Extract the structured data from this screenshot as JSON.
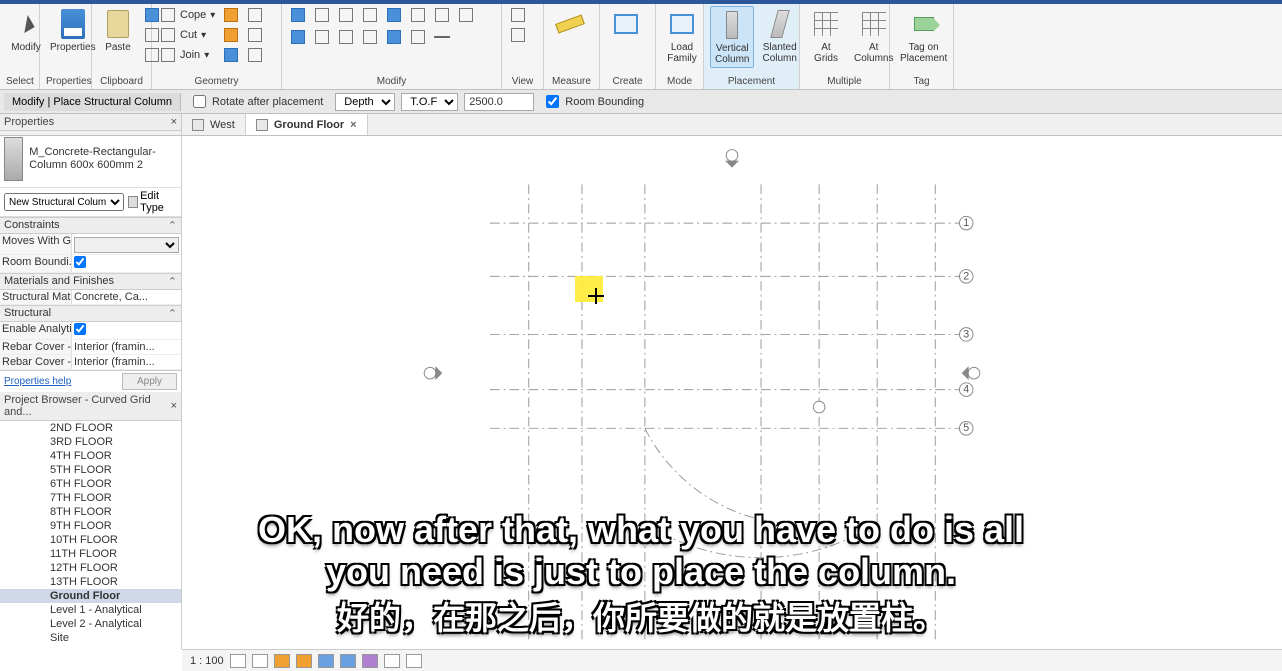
{
  "ribbon": {
    "groups": {
      "select": "Select",
      "properties": "Properties",
      "clipboard": "Clipboard",
      "geometry": "Geometry",
      "modify": "Modify",
      "view": "View",
      "measure": "Measure",
      "create": "Create",
      "mode": "Mode",
      "placement": "Placement",
      "multiple": "Multiple",
      "tag": "Tag"
    },
    "modify_label": "Modify",
    "properties_label": "Properties",
    "paste_label": "Paste",
    "cope_label": "Cope",
    "cut_label": "Cut",
    "join_label": "Join",
    "load_family": "Load\nFamily",
    "vertical_column": "Vertical\nColumn",
    "slanted_column": "Slanted\nColumn",
    "at_grids": "At\nGrids",
    "at_columns": "At\nColumns",
    "tag_on_placement": "Tag on\nPlacement"
  },
  "options_bar": {
    "context": "Modify | Place Structural Column",
    "rotate_after": "Rotate after placement",
    "depth_label": "Depth",
    "depth_mode": "T.O.F",
    "depth_value": "2500.0",
    "room_bounding": "Room Bounding"
  },
  "tabs": {
    "west": "West",
    "ground": "Ground Floor"
  },
  "properties_panel": {
    "title": "Properties",
    "type_name": "M_Concrete-Rectangular-Column 600x 600mm 2",
    "category": "New Structural Colum",
    "edit_type": "Edit Type",
    "cat_constraints": "Constraints",
    "moves_with": "Moves With G...",
    "room_bounding": "Room Boundi...",
    "cat_materials": "Materials and Finishes",
    "structural_mat": "Structural Mat...",
    "structural_mat_val": "Concrete, Ca...",
    "cat_structural": "Structural",
    "enable_analytic": "Enable Analyti...",
    "rebar1": "Rebar Cover - ...",
    "rebar1_val": "Interior (framin...",
    "rebar2": "Rebar Cover - ...",
    "rebar2_val": "Interior (framin...",
    "help": "Properties help",
    "apply": "Apply"
  },
  "browser": {
    "title": "Project Browser - Curved Grid and...",
    "items": [
      "2ND FLOOR",
      "3RD FLOOR",
      "4TH FLOOR",
      "5TH FLOOR",
      "6TH FLOOR",
      "7TH FLOOR",
      "8TH FLOOR",
      "9TH FLOOR",
      "10TH FLOOR",
      "11TH FLOOR",
      "12TH FLOOR",
      "13TH FLOOR",
      "Ground Floor",
      "Level 1 - Analytical",
      "Level 2 - Analytical",
      "Site"
    ],
    "selected": "Ground Floor"
  },
  "view_control": {
    "scale": "1 : 100"
  },
  "subtitles": {
    "en1": "OK, now after that, what you have to do is all",
    "en2": "you need is just to place the column.",
    "zh": "好的，在那之后，你所要做的就是放置柱。"
  },
  "grid_labels": [
    "1",
    "2",
    "3",
    "4",
    "5"
  ]
}
